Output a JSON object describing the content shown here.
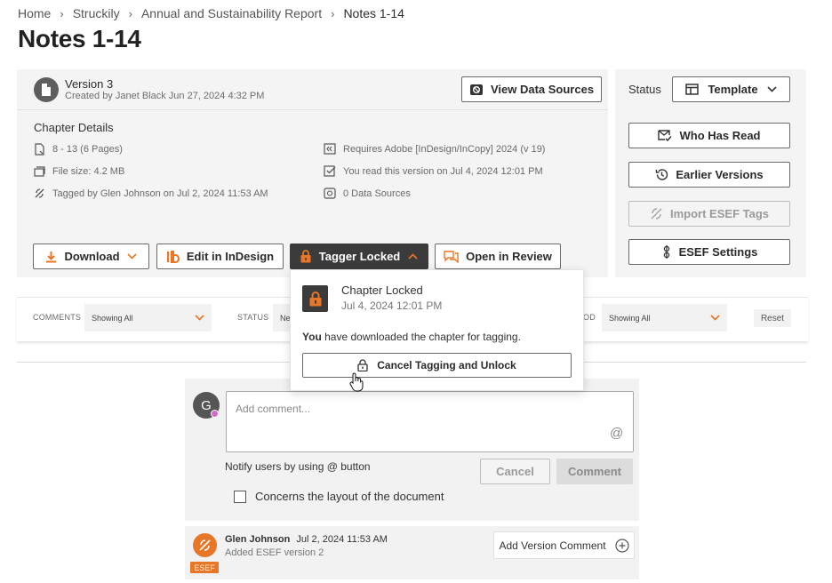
{
  "breadcrumb": {
    "items": [
      "Home",
      "Struckily",
      "Annual and Sustainability Report"
    ],
    "current": "Notes 1-14",
    "separator": "›"
  },
  "page_title": "Notes 1-14",
  "version": {
    "title": "Version 3",
    "created": "Created by Janet Black Jun 27, 2024 4:32 PM",
    "view_data_sources_label": "View Data Sources"
  },
  "chapter_details": {
    "title": "Chapter Details",
    "pages": "8 - 13 (6 Pages)",
    "file_size": "File size: 4.2 MB",
    "tagged_by": "Tagged by Glen Johnson on Jul 2, 2024 11:53 AM",
    "requires": "Requires Adobe [InDesign/InCopy] 2024 (v 19)",
    "read_version": "You read this version on Jul 4, 2024 12:01 PM",
    "data_sources": "0 Data Sources"
  },
  "actions": {
    "download_label": "Download",
    "edit_label": "Edit in InDesign",
    "tagger_label": "Tagger Locked",
    "review_label": "Open in Review"
  },
  "sidebar": {
    "status_label": "Status",
    "status_value": "Template",
    "who_has_read": "Who Has Read",
    "earlier_versions": "Earlier Versions",
    "import_esef": "Import ESEF Tags",
    "esef_settings": "ESEF Settings"
  },
  "filters": {
    "comments_label": "COMMENTS",
    "comments_value": "Showing All",
    "status_label": "STATUS",
    "status_value": "Ne",
    "period_label": "OD",
    "period_value": "Showing All",
    "reset_label": "Reset"
  },
  "popover": {
    "title": "Chapter Locked",
    "date": "Jul 4, 2024 12:01 PM",
    "message_strong": "You",
    "message_rest": " have downloaded the chapter for tagging.",
    "cancel_unlock_label": "Cancel Tagging and Unlock"
  },
  "comment": {
    "avatar_initial": "G",
    "placeholder": "Add comment...",
    "at_symbol": "@",
    "notify_text": "Notify users by using @ button",
    "cancel_label": "Cancel",
    "submit_label": "Comment",
    "concerns_label": "Concerns the layout of the document"
  },
  "history": {
    "name": "Glen Johnson",
    "time": "Jul 2, 2024 11:53 AM",
    "subtitle": "Added ESEF version 2",
    "badge": "ESEF",
    "add_version_label": "Add Version Comment"
  },
  "colors": {
    "accent_orange": "#e87626",
    "dark_button": "#3b3b3b",
    "panel_bg": "#f4f4f4",
    "avatar_dot": "#d36bc4"
  }
}
